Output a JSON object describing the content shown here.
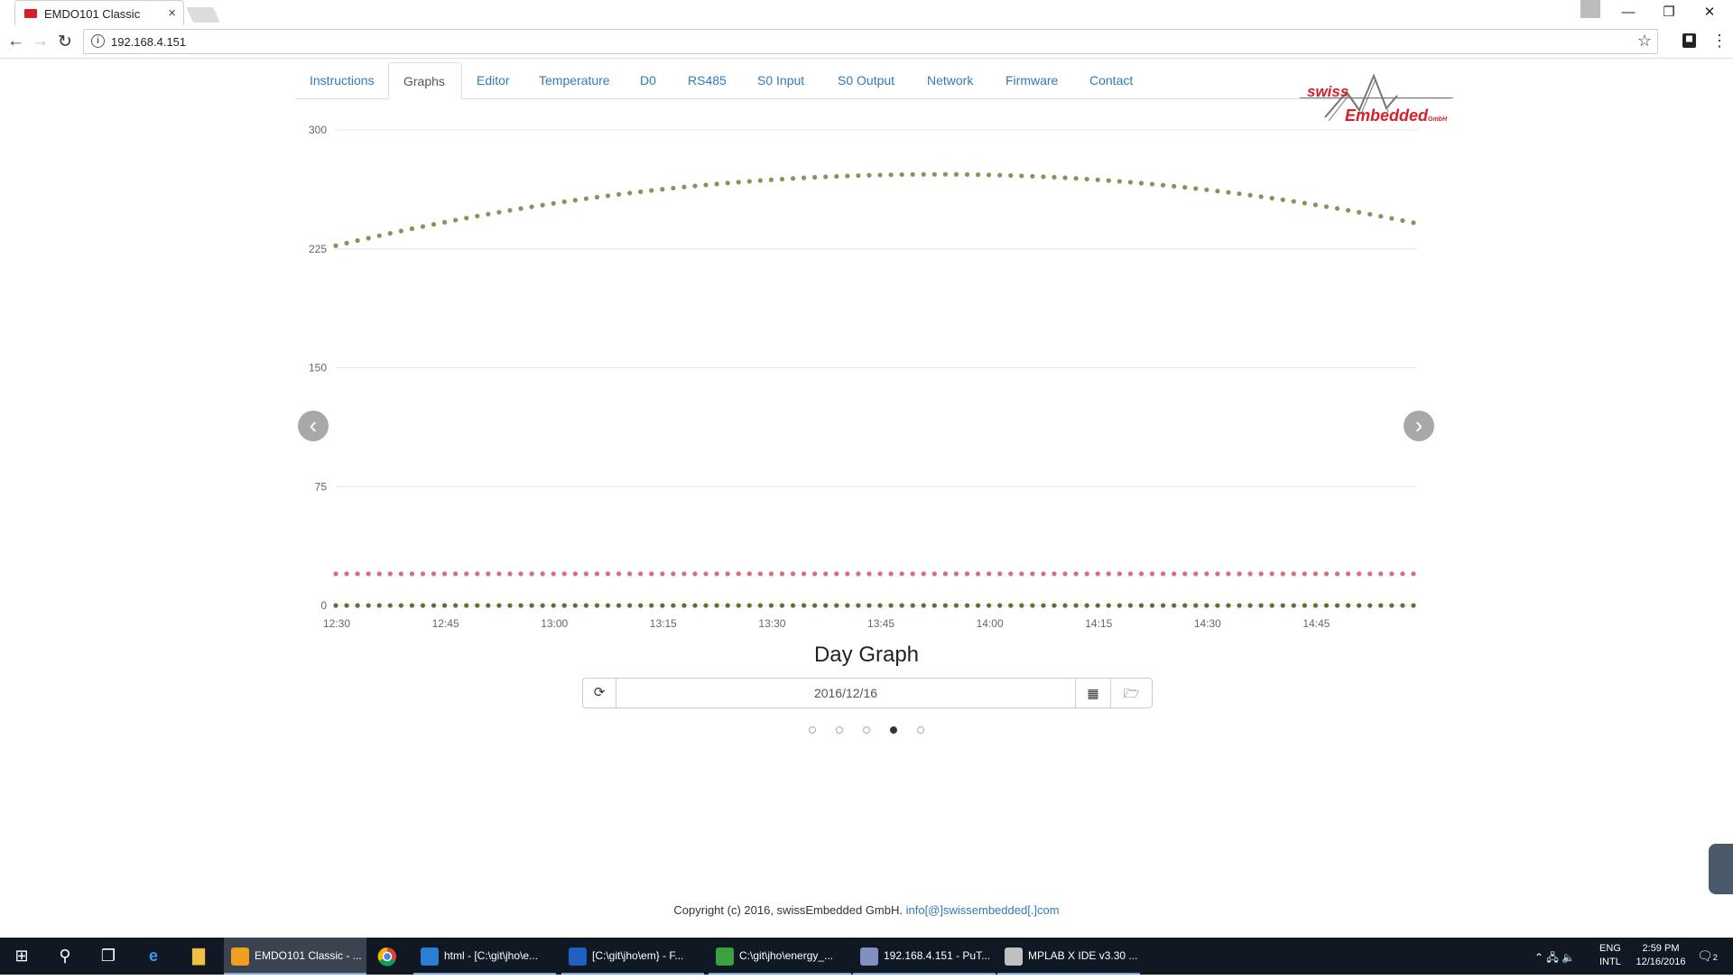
{
  "browser": {
    "tab_title": "EMDO101 Classic",
    "tab_close": "×",
    "url": "192.168.4.151",
    "window_controls": {
      "minimize": "—",
      "restore": "❐",
      "close": "✕"
    }
  },
  "nav": {
    "tabs": [
      "Instructions",
      "Graphs",
      "Editor",
      "Temperature",
      "D0",
      "RS485",
      "S0 Input",
      "S0 Output",
      "Network",
      "Firmware",
      "Contact"
    ],
    "active_index": 1
  },
  "logo": {
    "line1": "swiss",
    "line2": "Embedded",
    "suffix": "GmbH"
  },
  "chart_data": {
    "type": "scatter",
    "yticks": [
      "0",
      "75",
      "150",
      "225",
      "300"
    ],
    "ylim": [
      0,
      300
    ],
    "xticks": [
      "12:30",
      "12:45",
      "13:00",
      "13:15",
      "13:30",
      "13:45",
      "14:00",
      "14:15",
      "14:30",
      "14:45"
    ],
    "x_range": [
      "12:30",
      "14:59"
    ],
    "grid": true,
    "series": [
      {
        "color": "#8f8f5a",
        "start_value": 227,
        "peak_value": 272,
        "peak_time": "13:53",
        "end_value": 241,
        "shape": "arc"
      },
      {
        "color": "#d4707a",
        "constant_value": 20
      },
      {
        "color": "#6b6b34",
        "constant_value": 0
      }
    ]
  },
  "carousel": {
    "prev_icon": "‹",
    "next_icon": "›",
    "indicator_count": 5,
    "active_indicator": 3
  },
  "graph": {
    "title": "Day Graph",
    "date": "2016/12/16",
    "refresh_icon": "⟳",
    "calendar_icon": "▦",
    "folder_icon": "🗁"
  },
  "footer": {
    "text": "Copyright (c) 2016, swissEmbedded GmbH. ",
    "email": "info[@]swissembedded[.]com"
  },
  "taskbar": {
    "apps": [
      {
        "label": "EMDO101 Classic - ...",
        "color": "#f0a020",
        "state": "active"
      },
      {
        "label": "html - [C:\\git\\jho\\e...",
        "color": "#2a7fd4",
        "state": "open"
      },
      {
        "label": "[C:\\git\\jho\\em} - F...",
        "color": "#2060c0",
        "state": "open"
      },
      {
        "label": "C:\\git\\jho\\energy_...",
        "color": "#3aa040",
        "state": "open"
      },
      {
        "label": "192.168.4.151 - PuT...",
        "color": "#8090c0",
        "state": "open"
      },
      {
        "label": "MPLAB X IDE v3.30 ...",
        "color": "#c0c0c0",
        "state": "open"
      }
    ],
    "lang": "ENG",
    "layout": "INTL",
    "time": "2:59 PM",
    "date": "12/16/2016",
    "notifications": "2"
  }
}
